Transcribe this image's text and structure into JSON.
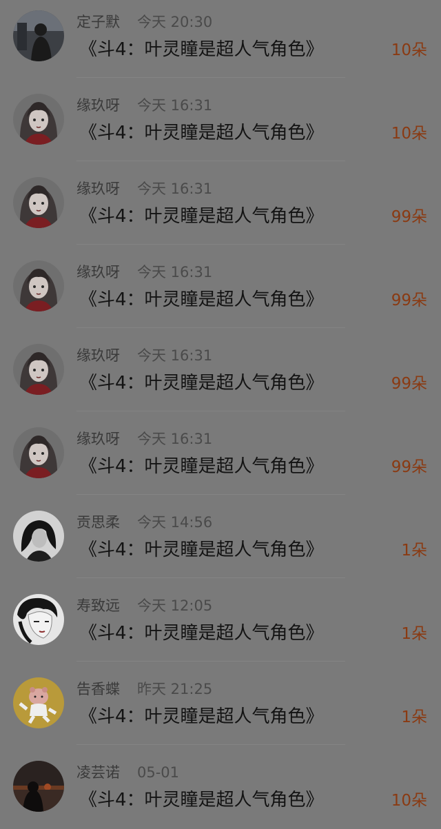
{
  "gift_list": [
    {
      "username": "定子默",
      "time": "今天 20:30",
      "message": "《斗4：叶灵瞳是超人气角色》",
      "amount": "10朵",
      "avatar": "boy-photo-avatar"
    },
    {
      "username": "缘玖呀",
      "time": "今天 16:31",
      "message": "《斗4：叶灵瞳是超人气角色》",
      "amount": "10朵",
      "avatar": "anime-girl-avatar"
    },
    {
      "username": "缘玖呀",
      "time": "今天 16:31",
      "message": "《斗4：叶灵瞳是超人气角色》",
      "amount": "99朵",
      "avatar": "anime-girl-avatar"
    },
    {
      "username": "缘玖呀",
      "time": "今天 16:31",
      "message": "《斗4：叶灵瞳是超人气角色》",
      "amount": "99朵",
      "avatar": "anime-girl-avatar"
    },
    {
      "username": "缘玖呀",
      "time": "今天 16:31",
      "message": "《斗4：叶灵瞳是超人气角色》",
      "amount": "99朵",
      "avatar": "anime-girl-avatar"
    },
    {
      "username": "缘玖呀",
      "time": "今天 16:31",
      "message": "《斗4：叶灵瞳是超人气角色》",
      "amount": "99朵",
      "avatar": "anime-girl-avatar"
    },
    {
      "username": "贡思柔",
      "time": "今天 14:56",
      "message": "《斗4：叶灵瞳是超人气角色》",
      "amount": "1朵",
      "avatar": "bw-girl-avatar"
    },
    {
      "username": "寿致远",
      "time": "今天 12:05",
      "message": "《斗4：叶灵瞳是超人气角色》",
      "amount": "1朵",
      "avatar": "sketch-girl-avatar"
    },
    {
      "username": "告香蝶",
      "time": "昨天 21:25",
      "message": "《斗4：叶灵瞳是超人气角色》",
      "amount": "1朵",
      "avatar": "cartoon-kid-avatar"
    },
    {
      "username": "凌芸诺",
      "time": "05-01",
      "message": "《斗4：叶灵瞳是超人气角色》",
      "amount": "10朵",
      "avatar": "sunset-avatar"
    }
  ],
  "colors": {
    "overlay_background": "#7a7a7a",
    "amount_text": "#8a3a12",
    "title_text": "#131313",
    "meta_text": "#3a3a3a"
  }
}
